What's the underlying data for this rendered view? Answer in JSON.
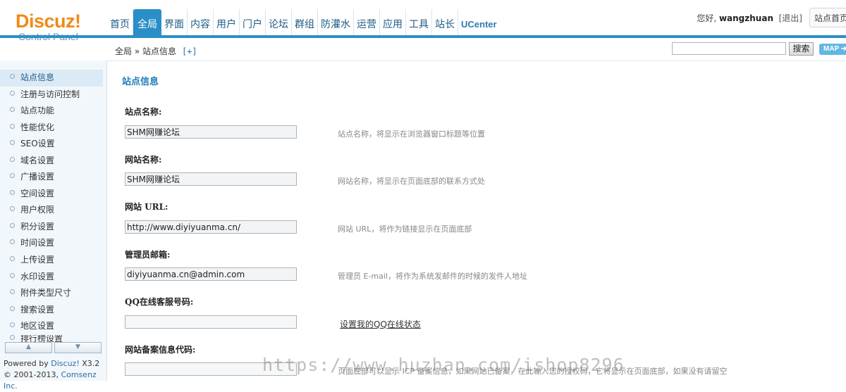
{
  "header": {
    "logo_brand": "Discuz!",
    "logo_sub": "Control Panel",
    "nav": [
      {
        "label": "首页"
      },
      {
        "label": "全局",
        "active": true
      },
      {
        "label": "界面"
      },
      {
        "label": "内容"
      },
      {
        "label": "用户"
      },
      {
        "label": "门户"
      },
      {
        "label": "论坛"
      },
      {
        "label": "群组"
      },
      {
        "label": "防灌水"
      },
      {
        "label": "运营"
      },
      {
        "label": "应用"
      },
      {
        "label": "工具"
      },
      {
        "label": "站长"
      },
      {
        "label": "UCenter"
      }
    ],
    "greeting": "您好, ",
    "username": "wangzhuan",
    "logout_label": "[退出]",
    "site_home_label": "站点首页"
  },
  "breadcrumb": {
    "path": "全局 » 站点信息",
    "add_label": "[+]"
  },
  "search": {
    "value": "",
    "button_label": "搜索",
    "map_label": "MAP ➔"
  },
  "sidebar": {
    "items": [
      {
        "label": "站点信息",
        "active": true
      },
      {
        "label": "注册与访问控制"
      },
      {
        "label": "站点功能"
      },
      {
        "label": "性能优化"
      },
      {
        "label": "SEO设置"
      },
      {
        "label": "域名设置"
      },
      {
        "label": "广播设置"
      },
      {
        "label": "空间设置"
      },
      {
        "label": "用户权限"
      },
      {
        "label": "积分设置"
      },
      {
        "label": "时间设置"
      },
      {
        "label": "上传设置"
      },
      {
        "label": "水印设置"
      },
      {
        "label": "附件类型尺寸"
      },
      {
        "label": "搜索设置"
      },
      {
        "label": "地区设置"
      },
      {
        "label": "排行榜设置"
      }
    ],
    "scroll_up": "▲",
    "scroll_down": "▼",
    "footer_powered": "Powered by ",
    "footer_brand": "Discuz!",
    "footer_version": " X3.2",
    "footer_copy": "© 2001-2013, ",
    "footer_company": "Comsenz Inc."
  },
  "main": {
    "title": "站点信息",
    "fields": [
      {
        "label": "站点名称:",
        "value": "SHM网赚论坛",
        "help": "站点名称，将显示在浏览器窗口标题等位置"
      },
      {
        "label": "网站名称:",
        "value": "SHM网赚论坛",
        "help": "网站名称，将显示在页面底部的联系方式处"
      },
      {
        "label": "网站 URL:",
        "value": "http://www.diyiyuanma.cn/",
        "help": "网站 URL，将作为链接显示在页面底部"
      },
      {
        "label": "管理员邮箱:",
        "value": "diyiyuanma.cn@admin.com",
        "help": "管理员 E-mail，将作为系统发邮件的时候的发件人地址"
      },
      {
        "label": "QQ在线客服号码:",
        "value": "",
        "link": "设置我的QQ在线状态"
      },
      {
        "label": "网站备案信息代码:",
        "value": "",
        "help": "页面底部可以显示 ICP 备案信息，如果网站已备案，在此输入您的授权码，它将显示在页面底部，如果没有请留空"
      }
    ]
  },
  "watermark": "https://www.huzhan.com/ishop8296"
}
